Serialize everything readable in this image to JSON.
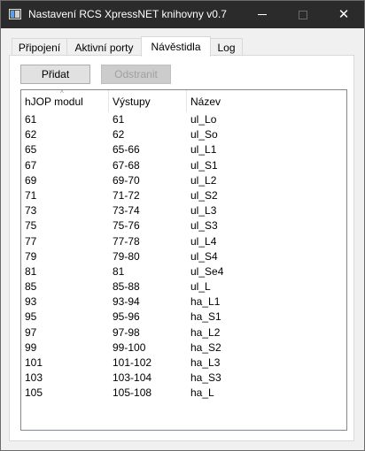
{
  "window": {
    "title": "Nastavení RCS XpressNET knihovny v0.7",
    "minimize_glyph": "",
    "close_glyph": "✕"
  },
  "tabs": [
    {
      "label": "Připojení",
      "active": false
    },
    {
      "label": "Aktivní porty",
      "active": false
    },
    {
      "label": "Návěstidla",
      "active": true
    },
    {
      "label": "Log",
      "active": false
    }
  ],
  "toolbar": {
    "add_label": "Přidat",
    "remove_label": "Odstranit",
    "remove_enabled": false
  },
  "list": {
    "columns": [
      "hJOP modul",
      "Výstupy",
      "Název"
    ],
    "sort_indicator": "^",
    "rows": [
      [
        "61",
        "61",
        "ul_Lo"
      ],
      [
        "62",
        "62",
        "ul_So"
      ],
      [
        "65",
        "65-66",
        "ul_L1"
      ],
      [
        "67",
        "67-68",
        "ul_S1"
      ],
      [
        "69",
        "69-70",
        "ul_L2"
      ],
      [
        "71",
        "71-72",
        "ul_S2"
      ],
      [
        "73",
        "73-74",
        "ul_L3"
      ],
      [
        "75",
        "75-76",
        "ul_S3"
      ],
      [
        "77",
        "77-78",
        "ul_L4"
      ],
      [
        "79",
        "79-80",
        "ul_S4"
      ],
      [
        "81",
        "81",
        "ul_Se4"
      ],
      [
        "85",
        "85-88",
        "ul_L"
      ],
      [
        "93",
        "93-94",
        "ha_L1"
      ],
      [
        "95",
        "95-96",
        "ha_S1"
      ],
      [
        "97",
        "97-98",
        "ha_L2"
      ],
      [
        "99",
        "99-100",
        "ha_S2"
      ],
      [
        "101",
        "101-102",
        "ha_L3"
      ],
      [
        "103",
        "103-104",
        "ha_S3"
      ],
      [
        "105",
        "105-108",
        "ha_L"
      ]
    ]
  },
  "colors": {
    "titlebar": "#2b2b2b",
    "window_bg": "#f0f0f0",
    "panel_bg": "#ffffff"
  }
}
